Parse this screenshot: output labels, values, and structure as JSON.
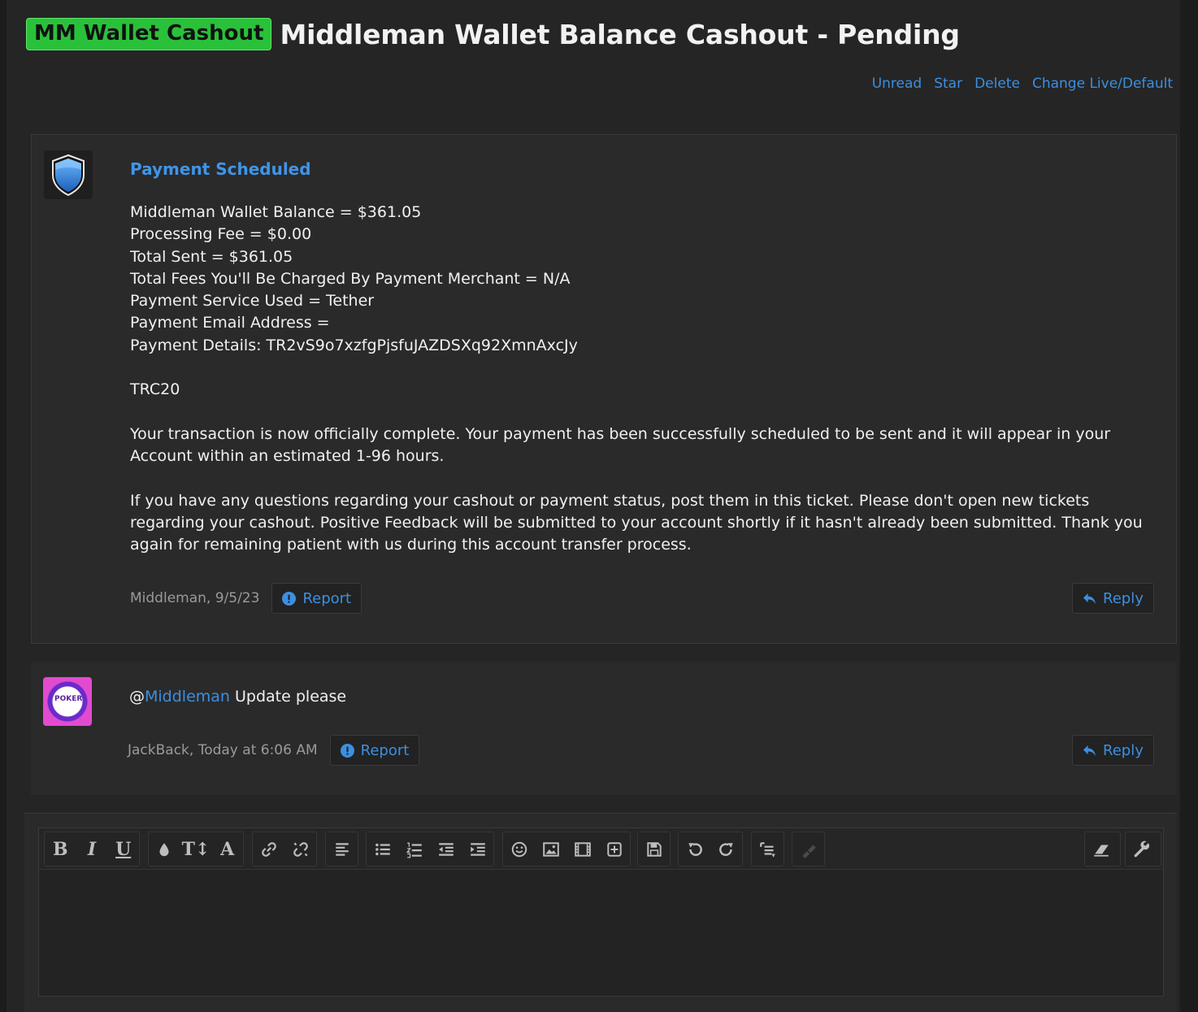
{
  "thread": {
    "prefix": "MM Wallet Cashout",
    "title": "Middleman Wallet Balance Cashout - Pending"
  },
  "actions": [
    "Unread",
    "Star",
    "Delete",
    "Change Live/Default"
  ],
  "messages": [
    {
      "heading": "Payment Scheduled",
      "lines": [
        "Middleman Wallet Balance = $361.05",
        "Processing Fee = $0.00",
        "Total Sent = $361.05",
        "Total Fees You'll Be Charged By Payment Merchant = N/A",
        "Payment Service Used = Tether",
        "Payment Email Address =",
        "Payment Details: TR2vS9o7xzfgPjsfuJAZDSXq92XmnAxcJy"
      ],
      "network": "TRC20",
      "para1": "Your transaction is now officially complete. Your payment has been successfully scheduled to be sent and it will appear in your Account within an estimated 1-96 hours.",
      "para2": "If you have any questions regarding your cashout or payment status, post them in this ticket. Please don't open new tickets regarding your cashout. Positive Feedback will be submitted to your account shortly if it hasn't already been submitted. Thank you again for remaining patient with us during this account transfer process.",
      "meta": "Middleman, 9/5/23",
      "report": "Report",
      "reply": "Reply"
    },
    {
      "at": "@",
      "mention": "Middleman",
      "text": " Update please",
      "avatar_text": "POKER",
      "meta": "JackBack, Today at 6:06 AM",
      "report": "Report",
      "reply": "Reply"
    }
  ],
  "editor": {
    "toolbar": [
      "bold-icon",
      "italic-icon",
      "underline-icon",
      "color-icon",
      "font-size-icon",
      "font-family-icon",
      "link-icon",
      "unlink-icon",
      "align-icon",
      "bullet-list-icon",
      "numbered-list-icon",
      "outdent-icon",
      "indent-icon",
      "smilie-icon",
      "image-icon",
      "media-icon",
      "insert-icon",
      "save-draft-icon",
      "undo-icon",
      "redo-icon",
      "bbcode-toggle-icon",
      "disabled-icon",
      "remove-format-icon",
      "settings-icon"
    ],
    "labels": {
      "bold": "B",
      "italic": "I",
      "underline": "U",
      "font_size": "T↕",
      "font_family": "A"
    }
  },
  "colors": {
    "accent": "#3d8fe0",
    "prefix_bg": "#2ac13a",
    "background": "#252525"
  }
}
